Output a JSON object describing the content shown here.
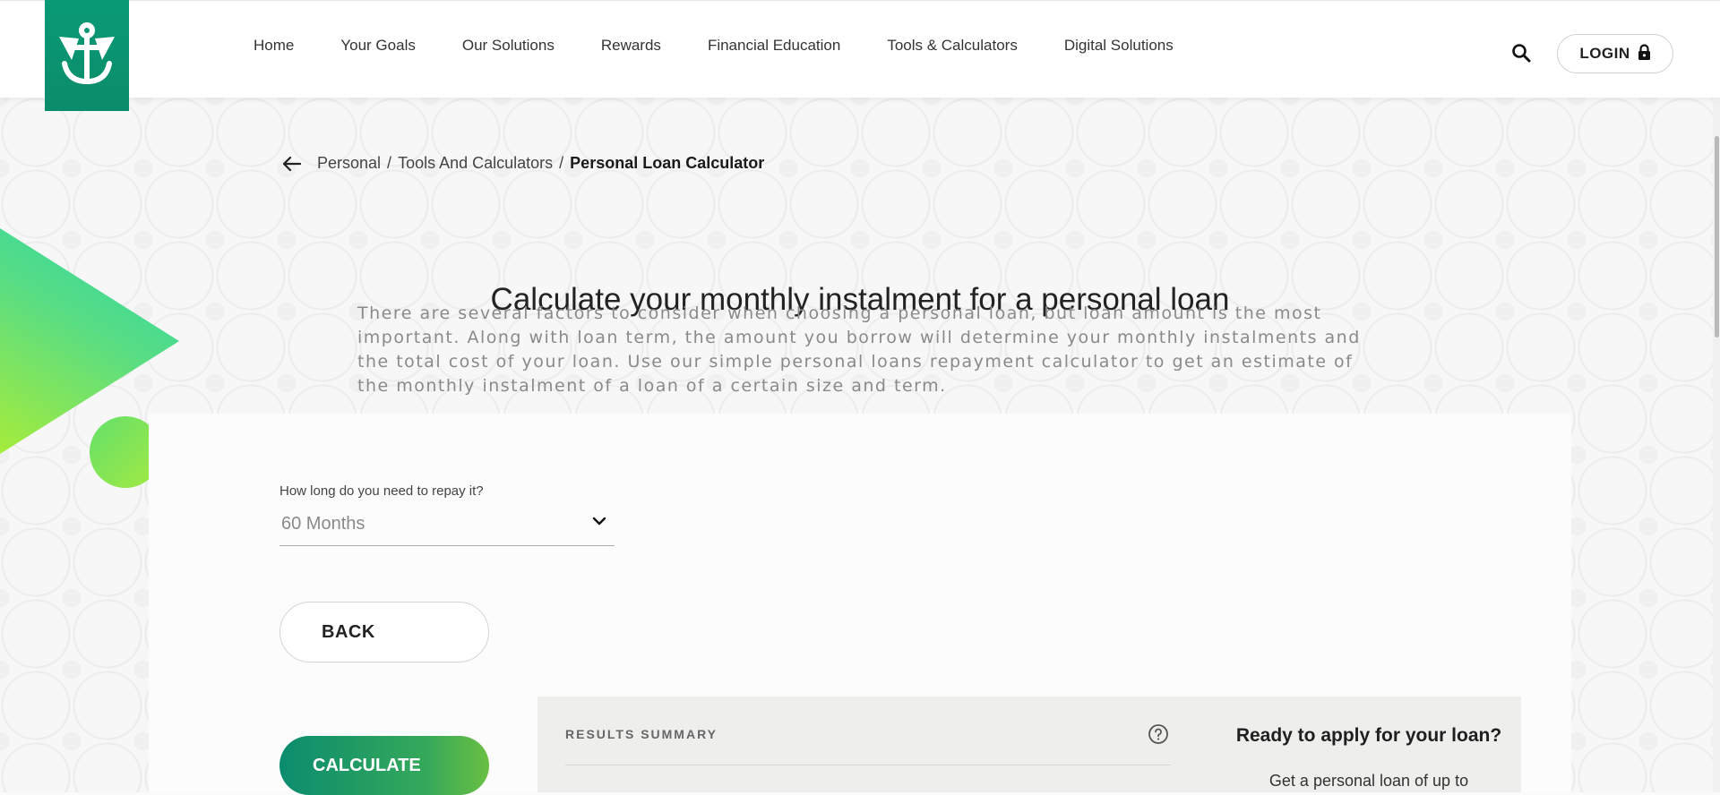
{
  "nav": {
    "items": [
      "Home",
      "Your Goals",
      "Our Solutions",
      "Rewards",
      "Financial Education",
      "Tools & Calculators",
      "Digital Solutions"
    ],
    "login_label": "LOGIN"
  },
  "breadcrumb": {
    "items": [
      "Personal",
      "Tools And Calculators"
    ],
    "separator": "/",
    "current": "Personal Loan Calculator"
  },
  "hero": {
    "title": "Calculate your monthly instalment for a personal loan",
    "description": "There are several factors to consider when choosing a personal loan, but loan amount is the most important. Along with loan term, the amount you borrow will determine your monthly instalments and the total cost of your loan. Use our simple personal loans repayment calculator to get an estimate of the monthly instalment of a loan of a certain size and term."
  },
  "form": {
    "term_label": "How long do you need to repay it?",
    "term_value": "60 Months",
    "back_label": "BACK",
    "calculate_label": "CALCULATE"
  },
  "results": {
    "label": "RESULTS SUMMARY",
    "apply_title": "Ready to apply for your loan?",
    "apply_text": "Get a personal loan of up to"
  },
  "colors": {
    "brand_green": "#0b8c6a",
    "accent_lime": "#a6ec3a",
    "accent_teal": "#2ad6a8"
  },
  "icons": {
    "logo": "anchor-shield-logo-icon",
    "search": "search-icon",
    "lock": "lock-icon",
    "back": "arrow-left-icon",
    "chevron": "chevron-down-icon",
    "help": "question-circle-icon"
  }
}
